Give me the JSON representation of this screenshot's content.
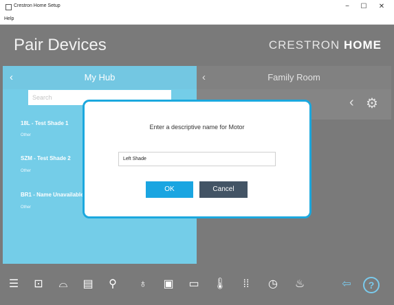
{
  "window": {
    "title": "Crestron Home Setup",
    "menu_help": "Help",
    "minimize_glyph": "−",
    "maximize_glyph": "☐",
    "close_glyph": "✕"
  },
  "header": {
    "page_title": "Pair Devices",
    "brand_light": "CRESTRON ",
    "brand_bold": "HOME"
  },
  "left_panel": {
    "title": "My Hub",
    "back_glyph": "‹",
    "search_placeholder": "Search",
    "devices": [
      {
        "name": "18L - Test Shade 1",
        "type": "Other"
      },
      {
        "name": "SZM - Test Shade 2",
        "type": "Other"
      },
      {
        "name": "BR1 - Name Unavailable",
        "type": "Other"
      }
    ]
  },
  "right_panel": {
    "title": "Family Room",
    "back_glyph": "‹",
    "chevron_glyph": "‹",
    "gear_glyph": "⚙"
  },
  "dialog": {
    "prompt": "Enter a descriptive name for Motor",
    "name_value": "Left Shade",
    "ok_label": "OK",
    "cancel_label": "Cancel"
  },
  "bottom_bar": {
    "icons": [
      {
        "name": "menu-icon",
        "glyph": "☰"
      },
      {
        "name": "add-room-icon",
        "glyph": "⊡"
      },
      {
        "name": "media-icon",
        "glyph": "⌓"
      },
      {
        "name": "shades-icon",
        "glyph": "▤"
      },
      {
        "name": "wiring-icon",
        "glyph": "⚲"
      },
      {
        "name": "lightbulb-icon",
        "glyph": "♁"
      },
      {
        "name": "panel-icon",
        "glyph": "▣"
      },
      {
        "name": "display-icon",
        "glyph": "▭"
      },
      {
        "name": "thermometer-icon",
        "glyph": "🌡"
      },
      {
        "name": "keypad-icon",
        "glyph": "⁞⁞"
      },
      {
        "name": "clock-icon",
        "glyph": "◷"
      },
      {
        "name": "climate-icon",
        "glyph": "♨"
      },
      {
        "name": "back-arrow-icon",
        "glyph": "⇦"
      }
    ],
    "help_glyph": "?"
  },
  "colors": {
    "accent": "#1aa5e1",
    "left_panel": "#11a9d8",
    "background": "#1b1b1b",
    "cancel": "#435465"
  }
}
